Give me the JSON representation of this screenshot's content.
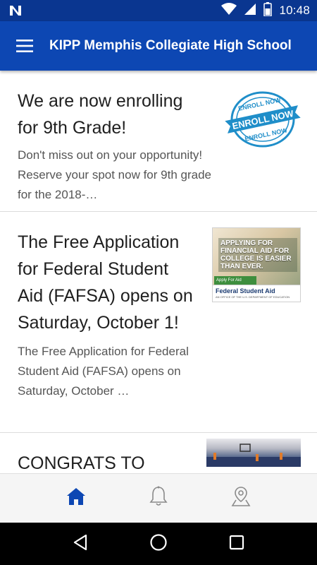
{
  "status_bar": {
    "time": "10:48",
    "icons": [
      "notification-n-icon",
      "wifi-icon",
      "cell-signal-icon",
      "battery-icon"
    ]
  },
  "app_bar": {
    "menu_icon": "hamburger-menu-icon",
    "title": "KIPP Memphis Collegiate High School"
  },
  "feed": {
    "items": [
      {
        "headline": "We are now enrolling for 9th Grade!",
        "summary": "Don't miss out on your opportunity! Reserve your spot now for 9th grade for the 2018-…",
        "thumbnail": {
          "kind": "enroll-now-stamp",
          "stamp_text_top": "ENROLL NOW",
          "stamp_text_center": "ENROLL NOW",
          "stamp_text_bottom": "ENROLL NOW"
        }
      },
      {
        "headline": "The Free Application for Federal Student Aid (FAFSA) opens on Saturday, October 1!",
        "summary": "The Free Application for Federal Student Aid (FAFSA) opens on Saturday, October …",
        "thumbnail": {
          "kind": "fafsa-ad",
          "ad_text": "APPLYING FOR FINANCIAL AID FOR COLLEGE IS EASIER THAN EVER.",
          "button_text": "Apply For Aid",
          "logo_text": "Federal Student Aid",
          "logo_subtext": "AN OFFICE OF THE U.S. DEPARTMENT OF EDUCATION"
        }
      },
      {
        "headline": "CONGRATS TO",
        "summary": "",
        "thumbnail": {
          "kind": "gym-photo"
        }
      }
    ]
  },
  "tab_bar": {
    "tabs": [
      {
        "icon": "home-icon",
        "active": true
      },
      {
        "icon": "bell-icon",
        "active": false
      },
      {
        "icon": "location-pin-icon",
        "active": false
      }
    ]
  },
  "nav_bar": {
    "buttons": [
      "back-icon",
      "home-circle-icon",
      "recents-icon"
    ]
  },
  "colors": {
    "status_bar": "#0a3690",
    "app_bar": "#0d47b3",
    "active_tab": "#0d47b3",
    "inactive_tab": "#8a8a8a",
    "stamp_blue": "#1f8ec9"
  }
}
